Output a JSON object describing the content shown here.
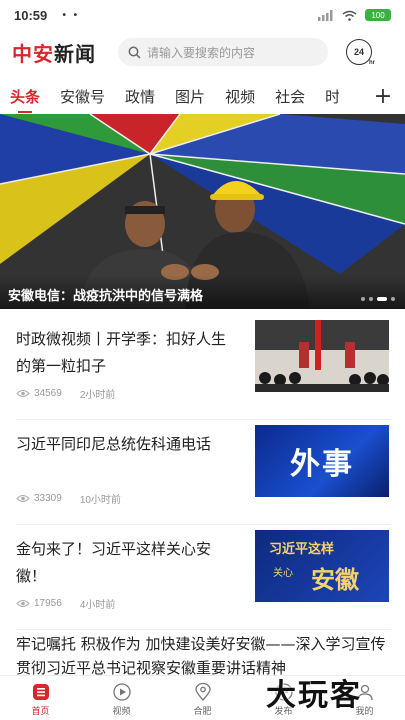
{
  "status_bar": {
    "time": "10:59",
    "dots": "• •",
    "battery": "100"
  },
  "header": {
    "logo_red": "中安",
    "logo_dark": "新闻",
    "search_placeholder": "请输入要搜索的内容",
    "badge_24": "24",
    "badge_hr": "hr"
  },
  "tabs": [
    "头条",
    "安徽号",
    "政情",
    "图片",
    "视频",
    "社会",
    "时"
  ],
  "tabs_plus": "+",
  "banner": {
    "caption": "安徽电信：战疫抗洪中的信号满格"
  },
  "news": [
    {
      "title": "时政微视频丨开学季：扣好人生的第一粒扣子",
      "views": "34569",
      "time": "2小时前"
    },
    {
      "title": "习近平同印尼总统佐科通电话",
      "views": "33309",
      "time": "10小时前",
      "thumb_text": "外事"
    },
    {
      "title": "金句来了！习近平这样关心安徽！",
      "views": "17956",
      "time": "4小时前",
      "thumb_text_1": "习近平这样",
      "thumb_text_2": "关心",
      "thumb_text_3": "安徽"
    }
  ],
  "news_full": {
    "title": "牢记嘱托 积极作为 加快建设美好安徽——深入学习宣传贯彻习近平总书记视察安徽重要讲话精神"
  },
  "bottom_nav": [
    {
      "label": "首页"
    },
    {
      "label": "视频"
    },
    {
      "label": "合肥"
    },
    {
      "label": "发布"
    },
    {
      "label": "我的"
    }
  ],
  "watermark": "大玩客",
  "colors": {
    "brand_red": "#d7262c",
    "meta_gray": "#999999"
  }
}
